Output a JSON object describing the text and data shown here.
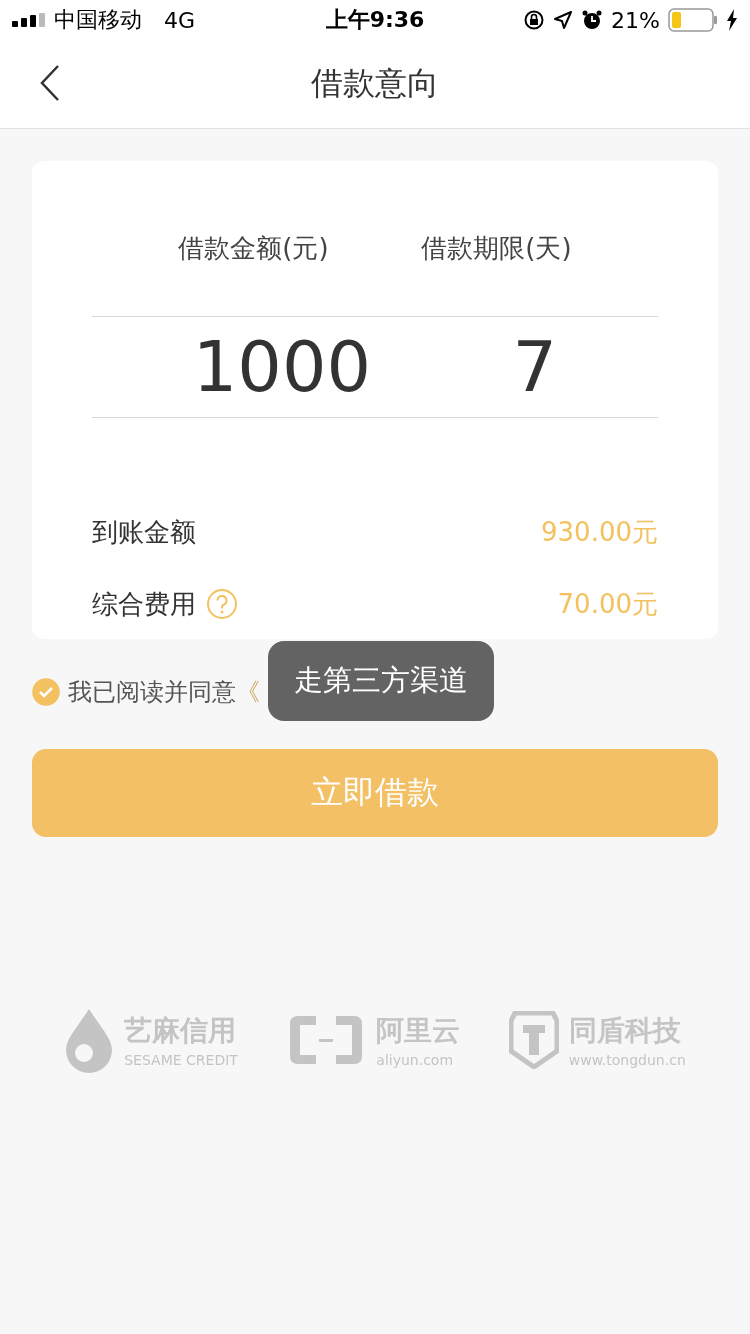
{
  "status_bar": {
    "carrier": "中国移动",
    "network": "4G",
    "time": "上午9:36",
    "battery": "21%"
  },
  "nav": {
    "title": "借款意向"
  },
  "picker": {
    "columns": [
      {
        "label": "借款金额(元)",
        "value": "1000"
      },
      {
        "label": "借款期限(天)",
        "value": "7"
      }
    ]
  },
  "summary": [
    {
      "label": "到账金额",
      "value": "930.00元",
      "help": false
    },
    {
      "label": "综合费用",
      "value": "70.00元",
      "help": true
    }
  ],
  "agreement": {
    "checked": true,
    "text": "我已阅读并同意",
    "link": "《"
  },
  "toast": "走第三方渠道",
  "submit": "立即借款",
  "partners": [
    {
      "kind": "sesame",
      "name": "艺麻信用",
      "sub": "SESAME CREDIT"
    },
    {
      "kind": "aliyun",
      "name": "阿里云",
      "sub": "aliyun.com"
    },
    {
      "kind": "tongdun",
      "name": "同盾科技",
      "sub": "www.tongdun.cn"
    }
  ]
}
